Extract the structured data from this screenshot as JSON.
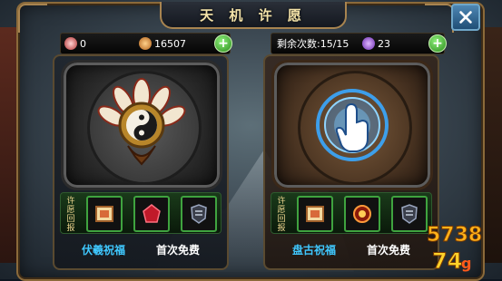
{
  "window": {
    "title": "天 机 许 愿",
    "close_icon": "close-x-icon"
  },
  "left_bar": {
    "currency1": {
      "icon": "gift-pouch-icon",
      "value": "0"
    },
    "currency2": {
      "icon": "copper-coin-icon",
      "value": "16507"
    },
    "add_icon": "plus-icon"
  },
  "right_bar": {
    "remaining_label": "剩余次数:15/15",
    "currency": {
      "icon": "purple-gem-icon",
      "value": "23"
    },
    "add_icon": "plus-icon"
  },
  "panels": [
    {
      "emblem": "lotus-yinyang-emblem",
      "items_label": "许愿回报",
      "items": [
        "scroll-icon",
        "red-gem-icon",
        "dark-armor-icon"
      ],
      "blessing": "伏羲祝福",
      "cost": "首次免费"
    },
    {
      "emblem": "tapping-hand-emblem",
      "items_label": "许愿回报",
      "items": [
        "scroll-icon",
        "fire-orb-icon",
        "dark-armor-icon"
      ],
      "blessing": "盘古祝福",
      "cost": "首次免费"
    }
  ],
  "watermark": {
    "text": "5738 4"
  },
  "colors": {
    "accent_gold": "#a88450",
    "blessing_blue": "#3fc8ff",
    "slot_green": "#3fa33f"
  }
}
